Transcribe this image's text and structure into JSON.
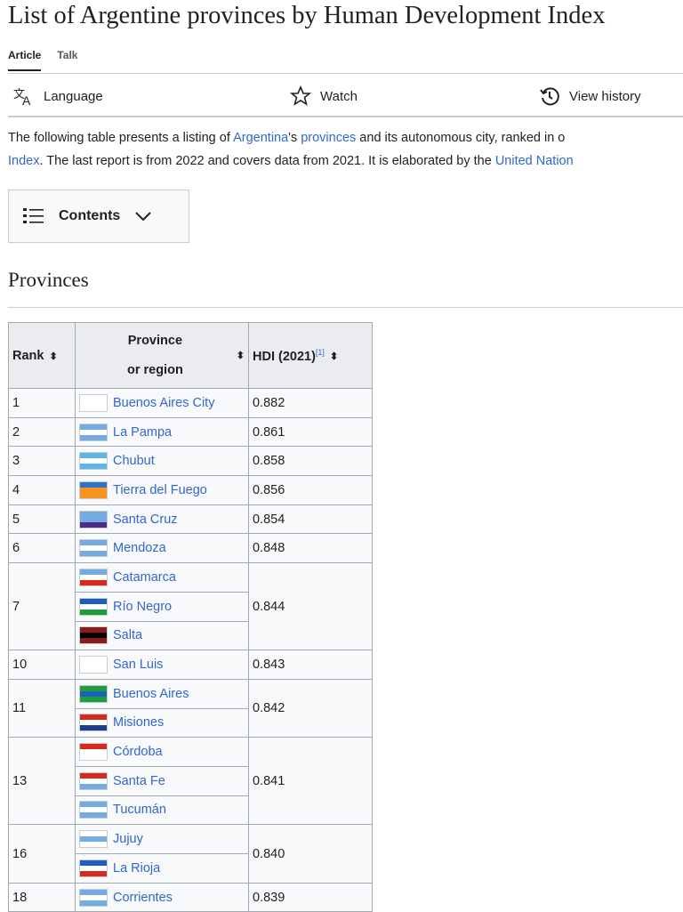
{
  "title": "List of Argentine provinces by Human Development Index",
  "tabs": {
    "article": "Article",
    "talk": "Talk"
  },
  "actions": {
    "language": "Language",
    "watch": "Watch",
    "history": "View history"
  },
  "intro": {
    "p1": "The following table presents a listing of ",
    "l1": "Argentina",
    "p2": "'s ",
    "l2": "provinces",
    "p3": " and its autonomous city, ranked in o",
    "l3": "Index",
    "p4": ". The last report is from 2022 and covers data from 2021. It is elaborated by the ",
    "l4": "United Nation"
  },
  "toc": {
    "label": "Contents"
  },
  "section": "Provinces",
  "table": {
    "headers": {
      "rank": "Rank",
      "prov1": "Province",
      "prov2": "or region",
      "hdi": "HDI (2021)",
      "ref": "[1]"
    },
    "groups": [
      {
        "rank": "1",
        "hdi": "0.882",
        "rows": [
          {
            "name": "Buenos Aires City",
            "flag": [
              "#ffffff",
              "#ffffff",
              "#ffffff"
            ]
          }
        ]
      },
      {
        "rank": "2",
        "hdi": "0.861",
        "rows": [
          {
            "name": "La Pampa",
            "flag": [
              "#74acdf",
              "#ffffff",
              "#74acdf"
            ]
          }
        ]
      },
      {
        "rank": "3",
        "hdi": "0.858",
        "rows": [
          {
            "name": "Chubut",
            "flag": [
              "#5eb6e4",
              "#ffffff",
              "#5eb6e4"
            ]
          }
        ]
      },
      {
        "rank": "4",
        "hdi": "0.856",
        "rows": [
          {
            "name": "Tierra del Fuego",
            "flag": [
              "#2f73c9",
              "#f7941d",
              "#f7941d"
            ]
          }
        ]
      },
      {
        "rank": "5",
        "hdi": "0.854",
        "rows": [
          {
            "name": "Santa Cruz",
            "flag": [
              "#74acdf",
              "#74acdf",
              "#4b2c8a"
            ]
          }
        ]
      },
      {
        "rank": "6",
        "hdi": "0.848",
        "rows": [
          {
            "name": "Mendoza",
            "flag": [
              "#74acdf",
              "#ffffff",
              "#74acdf"
            ]
          }
        ]
      },
      {
        "rank": "7",
        "hdi": "0.844",
        "rows": [
          {
            "name": "Catamarca",
            "flag": [
              "#74acdf",
              "#ffffff",
              "#d52b1e"
            ]
          },
          {
            "name": "Río Negro",
            "flag": [
              "#1d5fbf",
              "#ffffff",
              "#1c9e3c"
            ]
          },
          {
            "name": "Salta",
            "flag": [
              "#8b1a1a",
              "#000000",
              "#8b1a1a"
            ]
          }
        ]
      },
      {
        "rank": "10",
        "hdi": "0.843",
        "rows": [
          {
            "name": "San Luis",
            "flag": [
              "#ffffff",
              "#ffffff",
              "#ffffff"
            ]
          }
        ]
      },
      {
        "rank": "11",
        "hdi": "0.842",
        "rows": [
          {
            "name": "Buenos Aires",
            "flag": [
              "#1c9e3c",
              "#1d5fbf",
              "#1c9e3c"
            ]
          },
          {
            "name": "Misiones",
            "flag": [
              "#d52b1e",
              "#ffffff",
              "#1d3f8f"
            ]
          }
        ]
      },
      {
        "rank": "13",
        "hdi": "0.841",
        "rows": [
          {
            "name": "Córdoba",
            "flag": [
              "#d52b1e",
              "#ffffff",
              "#ffffff"
            ]
          },
          {
            "name": "Santa Fe",
            "flag": [
              "#d52b1e",
              "#ffffff",
              "#74acdf"
            ]
          },
          {
            "name": "Tucumán",
            "flag": [
              "#74acdf",
              "#ffffff",
              "#74acdf"
            ]
          }
        ]
      },
      {
        "rank": "16",
        "hdi": "0.840",
        "rows": [
          {
            "name": "Jujuy",
            "flag": [
              "#ffffff",
              "#74acdf",
              "#ffffff"
            ]
          },
          {
            "name": "La Rioja",
            "flag": [
              "#1d5fbf",
              "#ffffff",
              "#d52b1e"
            ]
          }
        ]
      },
      {
        "rank": "18",
        "hdi": "0.839",
        "rows": [
          {
            "name": "Corrientes",
            "flag": [
              "#74acdf",
              "#ffffff",
              "#74acdf"
            ]
          }
        ]
      }
    ]
  }
}
